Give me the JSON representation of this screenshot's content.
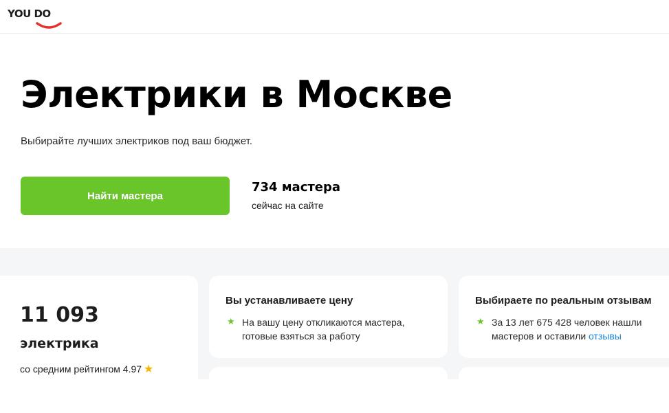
{
  "header": {
    "logo_text": "YOU DO"
  },
  "hero": {
    "title": "Электрики в Москве",
    "subtitle": "Выбирайте лучших электриков под ваш бюджет.",
    "cta_label": "Найти мастера",
    "masters_count": "734 мастера",
    "masters_online": "сейчас на сайте"
  },
  "stats": {
    "number": "11 093",
    "label": "электрика",
    "rating_text": "со средним рейтингом 4.97",
    "rating_icon": "star-icon"
  },
  "features": [
    {
      "title": "Вы устанавливаете цену",
      "text": "На вашу цену откликаются мастера, готовые взяться за работу"
    },
    {
      "title": "Выбираете по реальным отзывам",
      "text_before_link": "За 13 лет 675 428 человек нашли мастеров и оставили ",
      "link_text": "отзывы"
    }
  ],
  "colors": {
    "accent_green": "#6ac52b",
    "logo_red": "#e4312b",
    "link_blue": "#1a8ad6",
    "star_yellow": "#f5b400",
    "section_bg": "#f5f6f8"
  }
}
